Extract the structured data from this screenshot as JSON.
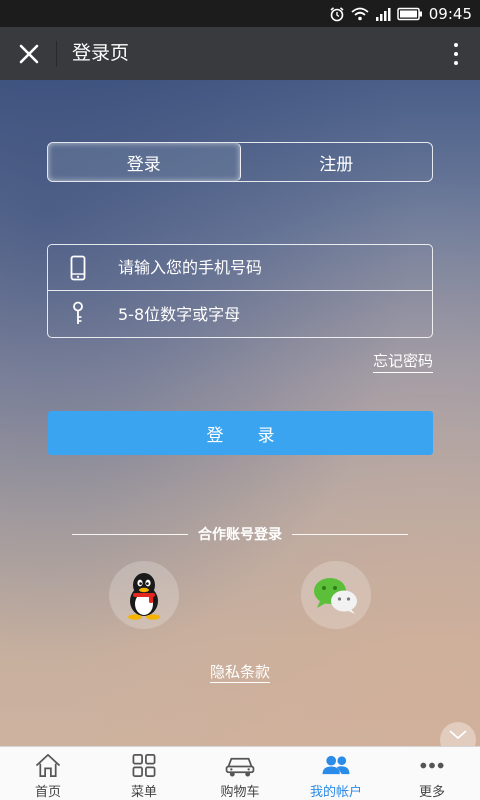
{
  "status_bar": {
    "time": "09:45"
  },
  "header": {
    "title": "登录页"
  },
  "tabs": [
    {
      "label": "登录",
      "active": true
    },
    {
      "label": "注册",
      "active": false
    }
  ],
  "form": {
    "phone_placeholder": "请输入您的手机号码",
    "password_placeholder": "5-8位数字或字母",
    "forgot_label": "忘记密码",
    "submit_label": "登录"
  },
  "partner": {
    "label": "合作账号登录",
    "providers": [
      "qq-icon",
      "wechat-icon"
    ]
  },
  "privacy_label": "隐私条款",
  "bottom_nav": [
    {
      "label": "首页",
      "icon": "home-icon",
      "active": false
    },
    {
      "label": "菜单",
      "icon": "grid-icon",
      "active": false
    },
    {
      "label": "购物车",
      "icon": "car-icon",
      "active": false
    },
    {
      "label": "我的帐户",
      "icon": "users-icon",
      "active": true
    },
    {
      "label": "更多",
      "icon": "more-dots-icon",
      "active": false
    }
  ],
  "colors": {
    "accent": "#3aa4f0",
    "active_nav": "#2a8be8",
    "titlebar": "#393a3e"
  }
}
